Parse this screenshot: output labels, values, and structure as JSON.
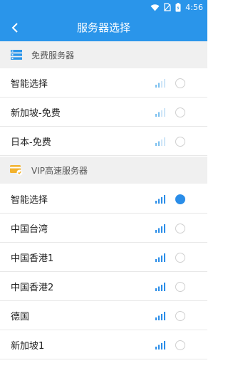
{
  "status_bar": {
    "time": "4:56"
  },
  "toolbar": {
    "title": "服务器选择"
  },
  "sections": [
    {
      "title": "免费服务器",
      "icon": "server-list-icon",
      "items": [
        {
          "label": "智能选择",
          "selected": false
        },
        {
          "label": "新加坡-免费",
          "selected": false
        },
        {
          "label": "日本-免费",
          "selected": false
        }
      ]
    },
    {
      "title": "VIP高速服务器",
      "icon": "vip-card-icon",
      "items": [
        {
          "label": "智能选择",
          "selected": true
        },
        {
          "label": "中国台湾",
          "selected": false
        },
        {
          "label": "中国香港1",
          "selected": false
        },
        {
          "label": "中国香港2",
          "selected": false
        },
        {
          "label": "德国",
          "selected": false
        },
        {
          "label": "新加坡1",
          "selected": false
        }
      ]
    }
  ],
  "colors": {
    "primary": "#2a95ea",
    "section_bg": "#f0f0f0",
    "free_signal": "#7cc0ef",
    "vip_signal": "#2a8de8",
    "vip_icon": "#f2b22e",
    "radio_selected": "#2a8de8"
  }
}
